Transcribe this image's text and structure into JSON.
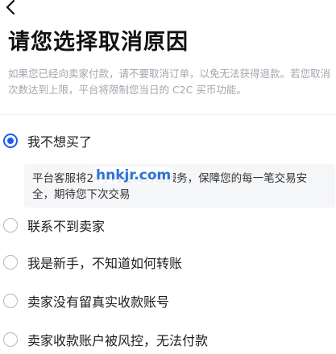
{
  "header": {
    "back_icon": "chevron-left-icon",
    "title": "请您选择取消原因"
  },
  "notice": "如果您已经向卖家付款，请不要取消订单，以免无法获得退款。若您取消次数达到上限，平台将限制您当日的 C2C 买币功能。",
  "options": [
    {
      "label": "我不想买了",
      "selected": true
    },
    {
      "label": "联系不到卖家",
      "selected": false
    },
    {
      "label": "我是新手，不知道如何转账",
      "selected": false
    },
    {
      "label": "卖家没有留真实收款账号",
      "selected": false
    },
    {
      "label": "卖家收款账户被风控，无法付款",
      "selected": false
    }
  ],
  "explanation": "平台客服将24小时在线为您服务，保障您的每一笔交易安全，期待您下次交易",
  "watermark": "hnkjr.com",
  "colors": {
    "accent": "#1c5cf2",
    "muted_text": "#a2a6ad",
    "panel_bg": "#f5f6f8",
    "watermark": "#2f72d9"
  }
}
